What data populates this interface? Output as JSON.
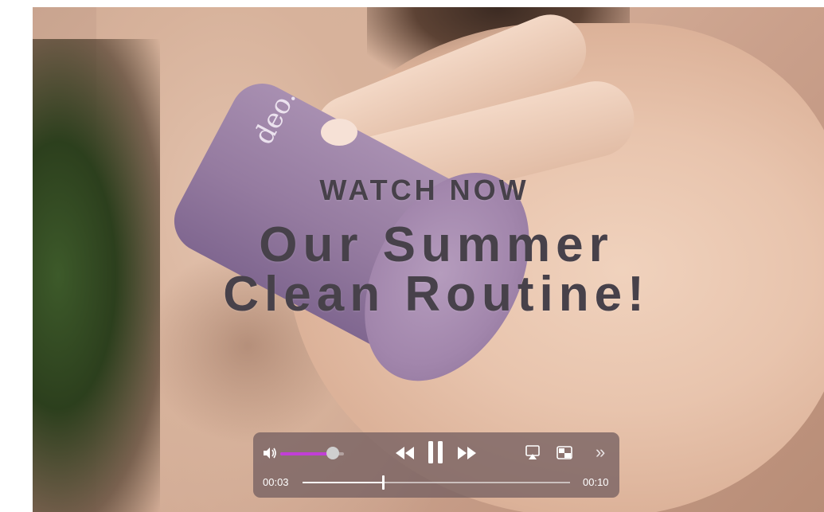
{
  "overlay": {
    "kicker": "WATCH NOW",
    "title_line1": "Our Summer",
    "title_line2": "Clean Routine!"
  },
  "product": {
    "logo_text": "deo."
  },
  "player": {
    "current_time": "00:03",
    "duration": "00:10",
    "progress_fraction": 0.3,
    "volume_fraction": 0.83,
    "volume_accent_color": "#c13fd6",
    "icons": [
      "volume-icon",
      "rewind-icon",
      "pause-icon",
      "forward-icon",
      "airplay-icon",
      "picture-in-picture-icon",
      "more-icon"
    ]
  }
}
